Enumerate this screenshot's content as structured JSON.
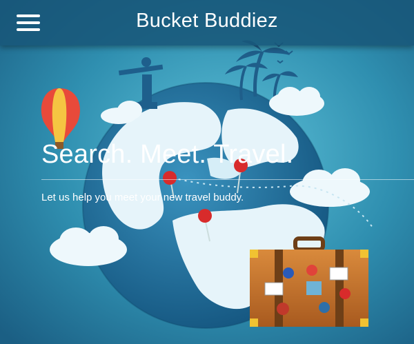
{
  "header": {
    "title": "Bucket Buddiez",
    "menu_icon": "hamburger-menu-icon"
  },
  "hero": {
    "tagline": "Search. Meet. Travel.",
    "subtitle": "Let us help you meet your new travel buddy."
  },
  "colors": {
    "background": "#2f8fb0",
    "header": "#185678",
    "globe_ocean": "#1f6f9b",
    "land": "#eaf6fb",
    "suitcase": "#c9782e",
    "pin": "#d82b2b"
  },
  "illustration": {
    "icons": [
      "globe-icon",
      "hot-air-balloon-icon",
      "palm-trees-icon",
      "statue-icon",
      "suitcase-icon",
      "map-pin-icon",
      "cloud-icon",
      "bird-icon"
    ]
  }
}
